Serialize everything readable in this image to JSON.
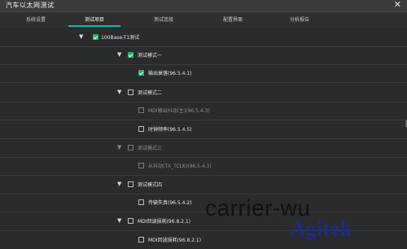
{
  "window": {
    "title": "汽车以太网测试",
    "close_icon": "close-icon"
  },
  "tabs": [
    {
      "label": "系统设置",
      "active": false
    },
    {
      "label": "测试项目",
      "active": true
    },
    {
      "label": "测试连接",
      "active": false
    },
    {
      "label": "配置界面",
      "active": false
    },
    {
      "label": "分析报告",
      "active": false
    }
  ],
  "tree": [
    {
      "label": "100Base-T1测试",
      "checked": true,
      "expandable": true,
      "enabled": true,
      "level": 0
    },
    {
      "label": "测试模式一",
      "checked": true,
      "expandable": true,
      "enabled": true,
      "level": 1
    },
    {
      "label": "输出衰落(96.5.4.1)",
      "checked": true,
      "expandable": false,
      "enabled": true,
      "level": 2
    },
    {
      "label": "测试模式二",
      "checked": false,
      "expandable": true,
      "enabled": true,
      "level": 1
    },
    {
      "label": "MDI输出抖动(主)(96.5.4.3)",
      "checked": false,
      "expandable": false,
      "enabled": false,
      "level": 2
    },
    {
      "label": "时钟频率(96.5.4.5)",
      "checked": false,
      "expandable": false,
      "enabled": true,
      "level": 2
    },
    {
      "label": "测试模式三",
      "checked": false,
      "expandable": true,
      "enabled": false,
      "level": 1
    },
    {
      "label": "从抖动(TX_TCLK)(96.5.4.3)",
      "checked": false,
      "expandable": false,
      "enabled": false,
      "level": 2
    },
    {
      "label": "测试模式四",
      "checked": false,
      "expandable": true,
      "enabled": true,
      "level": 1
    },
    {
      "label": "传输失真(96.5.4.2)",
      "checked": false,
      "expandable": false,
      "enabled": true,
      "level": 2
    },
    {
      "label": "MDI回波损耗(96.8.2.1)",
      "checked": false,
      "expandable": true,
      "enabled": true,
      "level": 1
    },
    {
      "label": "MDI回波损耗(96.8.2.1)",
      "checked": false,
      "expandable": false,
      "enabled": true,
      "level": 2
    }
  ],
  "watermark": {
    "line1": "carrier-wu",
    "line2": "Agitek"
  }
}
